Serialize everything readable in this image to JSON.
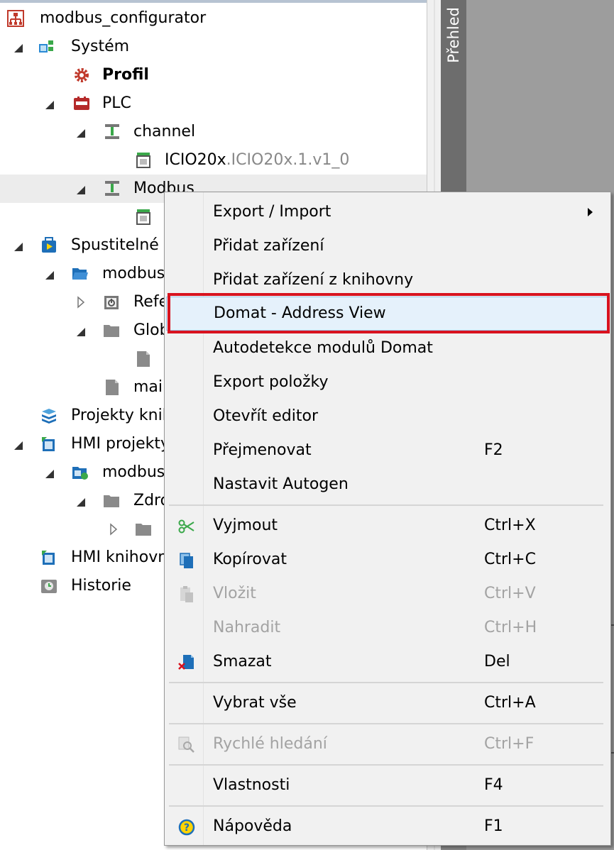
{
  "tree": {
    "root": {
      "label": "modbus_configurator",
      "icon": "project-icon"
    },
    "items": [
      {
        "label": "Systém",
        "icon": "system-icon"
      },
      {
        "label": "Profil",
        "icon": "gear-icon"
      },
      {
        "label": "PLC",
        "icon": "plc-icon"
      },
      {
        "label": "channel",
        "icon": "channel-icon"
      },
      {
        "label": "ICIO20x",
        "suffix": ".ICIO20x.1.v1_0",
        "icon": "module-icon"
      },
      {
        "label": "Modbus",
        "icon": "channel-icon"
      },
      {
        "label": "",
        "icon": "module-icon"
      },
      {
        "label": "Spustitelné p",
        "icon": "executable-icon"
      },
      {
        "label": "modbus",
        "icon": "folder-open-icon"
      },
      {
        "label": "Refe",
        "icon": "references-icon"
      },
      {
        "label": "Glob",
        "icon": "folder-icon"
      },
      {
        "label": "",
        "icon": "file-icon"
      },
      {
        "label": "mair",
        "icon": "file-icon"
      },
      {
        "label": "Projekty knih",
        "icon": "library-icon"
      },
      {
        "label": "HMI projekty",
        "icon": "hmi-icon"
      },
      {
        "label": "modbus",
        "icon": "hmi-folder-icon"
      },
      {
        "label": "Zdro",
        "icon": "folder-icon"
      },
      {
        "label": "",
        "icon": "folder-icon"
      },
      {
        "label": "HMI knihovn",
        "icon": "hmi-icon"
      },
      {
        "label": "Historie",
        "icon": "history-icon"
      }
    ]
  },
  "side_panel": {
    "tab_label": "Přehled"
  },
  "context_menu": {
    "items": [
      {
        "label": "Export / Import",
        "shortcut": "",
        "submenu": true
      },
      {
        "label": "Přidat zařízení",
        "shortcut": ""
      },
      {
        "label": "Přidat zařízení z knihovny",
        "shortcut": ""
      },
      {
        "label": "Domat - Address View",
        "shortcut": "",
        "highlighted": true
      },
      {
        "label": "Autodetekce modulů Domat",
        "shortcut": ""
      },
      {
        "label": "Export položky",
        "shortcut": ""
      },
      {
        "label": "Otevřít editor",
        "shortcut": ""
      },
      {
        "label": "Přejmenovat",
        "shortcut": "F2"
      },
      {
        "label": "Nastavit Autogen",
        "shortcut": ""
      },
      {
        "label": "Vyjmout",
        "shortcut": "Ctrl+X",
        "icon": "scissors-icon"
      },
      {
        "label": "Kopírovat",
        "shortcut": "Ctrl+C",
        "icon": "copy-icon"
      },
      {
        "label": "Vložit",
        "shortcut": "Ctrl+V",
        "icon": "paste-icon",
        "disabled": true
      },
      {
        "label": "Nahradit",
        "shortcut": "Ctrl+H",
        "disabled": true
      },
      {
        "label": "Smazat",
        "shortcut": "Del",
        "icon": "delete-icon"
      },
      {
        "label": "Vybrat vše",
        "shortcut": "Ctrl+A"
      },
      {
        "label": "Rychlé hledání",
        "shortcut": "Ctrl+F",
        "icon": "quick-search-icon",
        "disabled": true
      },
      {
        "label": "Vlastnosti",
        "shortcut": "F4"
      },
      {
        "label": "Nápověda",
        "shortcut": "F1",
        "icon": "help-icon"
      }
    ]
  },
  "colors": {
    "highlight_border": "#d8131f",
    "hover_bg": "#e5f1fb"
  }
}
